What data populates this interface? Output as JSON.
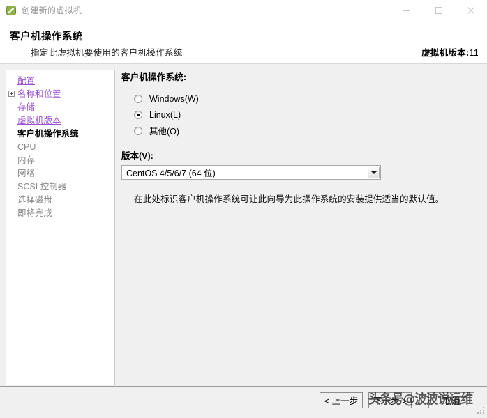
{
  "window": {
    "title": "创建新的虚拟机",
    "icon": "vm-wizard-icon",
    "controls": {
      "minimize": "minimize-icon",
      "maximize": "maximize-icon",
      "close": "close-icon"
    }
  },
  "header": {
    "title": "客户机操作系统",
    "subtitle": "指定此虚拟机要使用的客户机操作系统",
    "version_label": "虚拟机版本:",
    "version_value": "11"
  },
  "sidebar": {
    "items": [
      {
        "label": "配置",
        "state": "link",
        "expander": false
      },
      {
        "label": "名称和位置",
        "state": "link",
        "expander": true
      },
      {
        "label": "存储",
        "state": "link",
        "expander": false
      },
      {
        "label": "虚拟机版本",
        "state": "link",
        "expander": false
      },
      {
        "label": "客户机操作系统",
        "state": "current",
        "expander": false
      },
      {
        "label": "CPU",
        "state": "muted",
        "expander": false
      },
      {
        "label": "内存",
        "state": "muted",
        "expander": false
      },
      {
        "label": "网络",
        "state": "muted",
        "expander": false
      },
      {
        "label": "SCSI 控制器",
        "state": "muted",
        "expander": false
      },
      {
        "label": "选择磁盘",
        "state": "muted",
        "expander": false
      },
      {
        "label": "即将完成",
        "state": "muted",
        "expander": false
      }
    ]
  },
  "content": {
    "os_group_label": "客户机操作系统:",
    "os_options": [
      {
        "label": "Windows(W)",
        "checked": false
      },
      {
        "label": "Linux(L)",
        "checked": true
      },
      {
        "label": "其他(O)",
        "checked": false
      }
    ],
    "version_field_label": "版本(V):",
    "version_selected": "CentOS 4/5/6/7 (64 位)",
    "description": "在此处标识客户机操作系统可让此向导为此操作系统的安装提供适当的默认值。"
  },
  "footer": {
    "back_label": "< 上一步",
    "next_label": "下一步 >",
    "cancel_label": "取消"
  },
  "watermark": {
    "text": "头条号@波波说运维"
  },
  "colors": {
    "link": "#9a4fcf",
    "muted_text": "#8a8a8a",
    "dialog_bg": "#f0f0f0",
    "panel_bg": "#ffffff"
  }
}
